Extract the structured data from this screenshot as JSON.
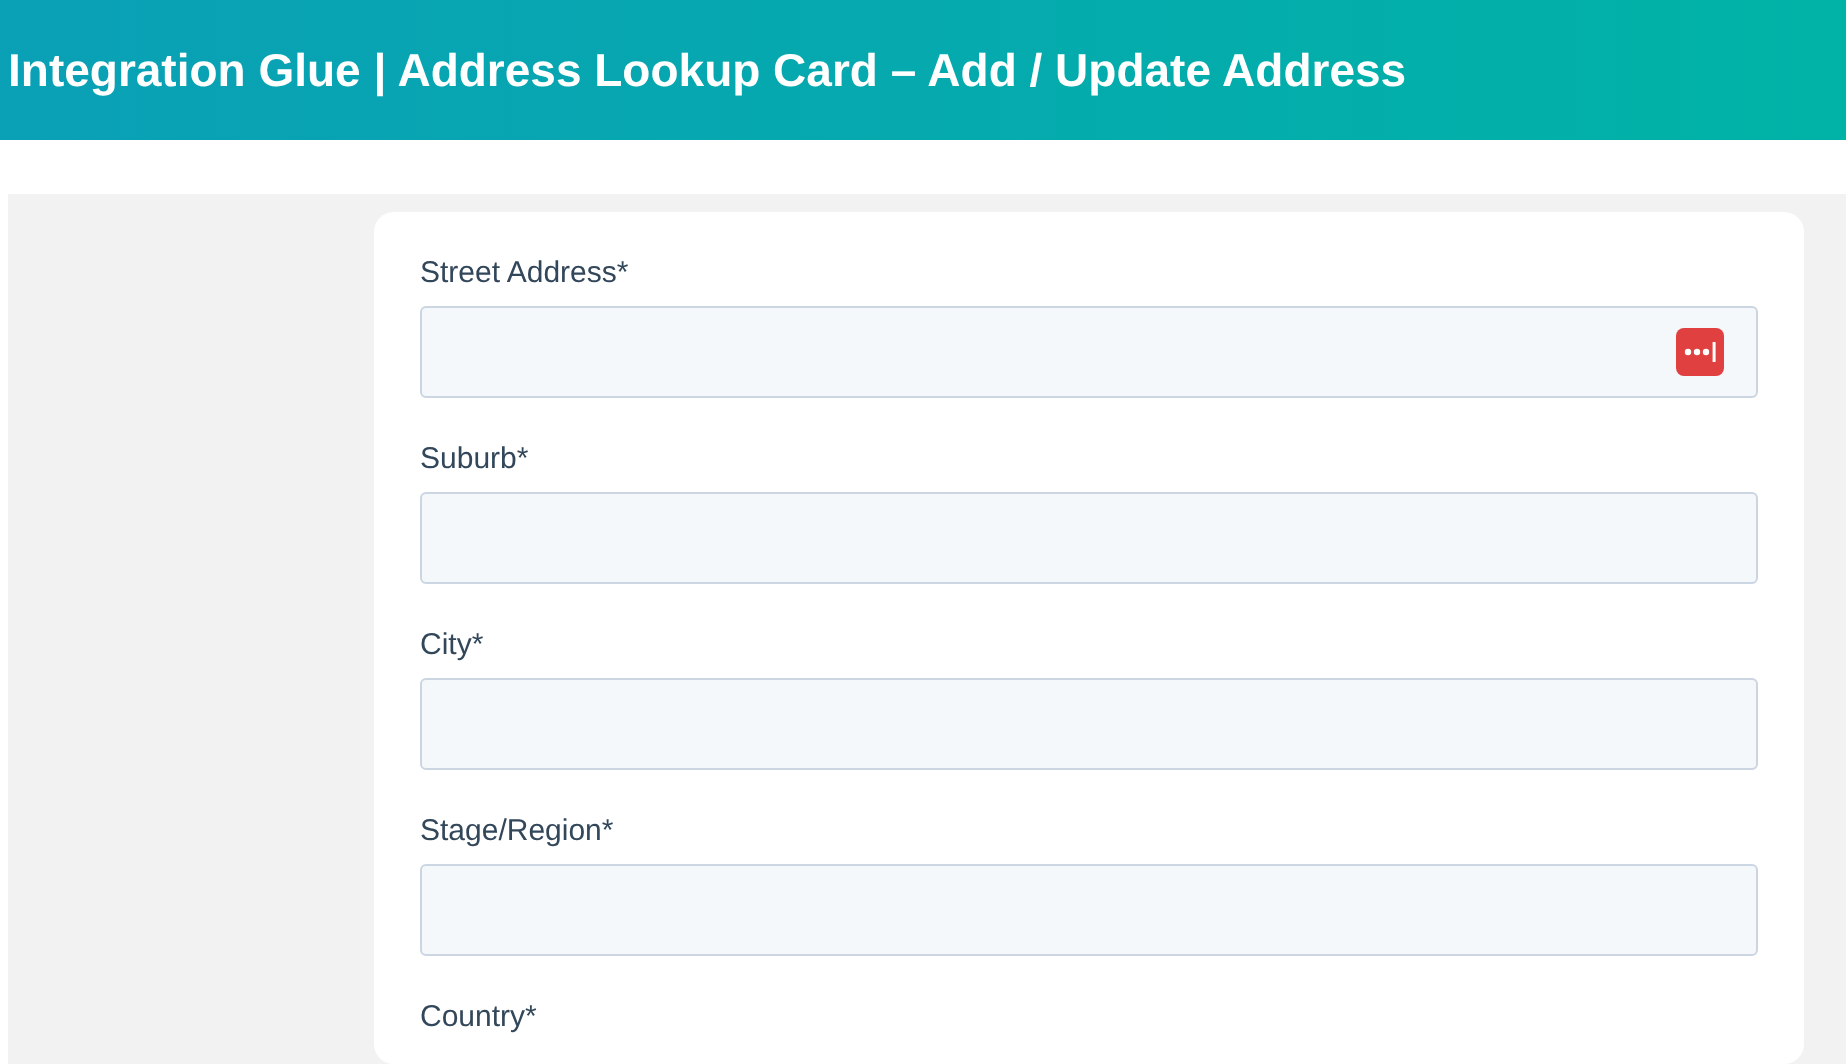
{
  "header": {
    "title": "Integration Glue | Address Lookup Card – Add / Update Address"
  },
  "fields": [
    {
      "kind": "input",
      "label": "Street Address*",
      "lookup_icon": true
    },
    {
      "kind": "input",
      "label": "Suburb*",
      "lookup_icon": false
    },
    {
      "kind": "input",
      "label": "City*",
      "lookup_icon": false
    },
    {
      "kind": "input",
      "label": "Stage/Region*",
      "lookup_icon": false
    },
    {
      "kind": "label",
      "label": "Country*"
    }
  ]
}
